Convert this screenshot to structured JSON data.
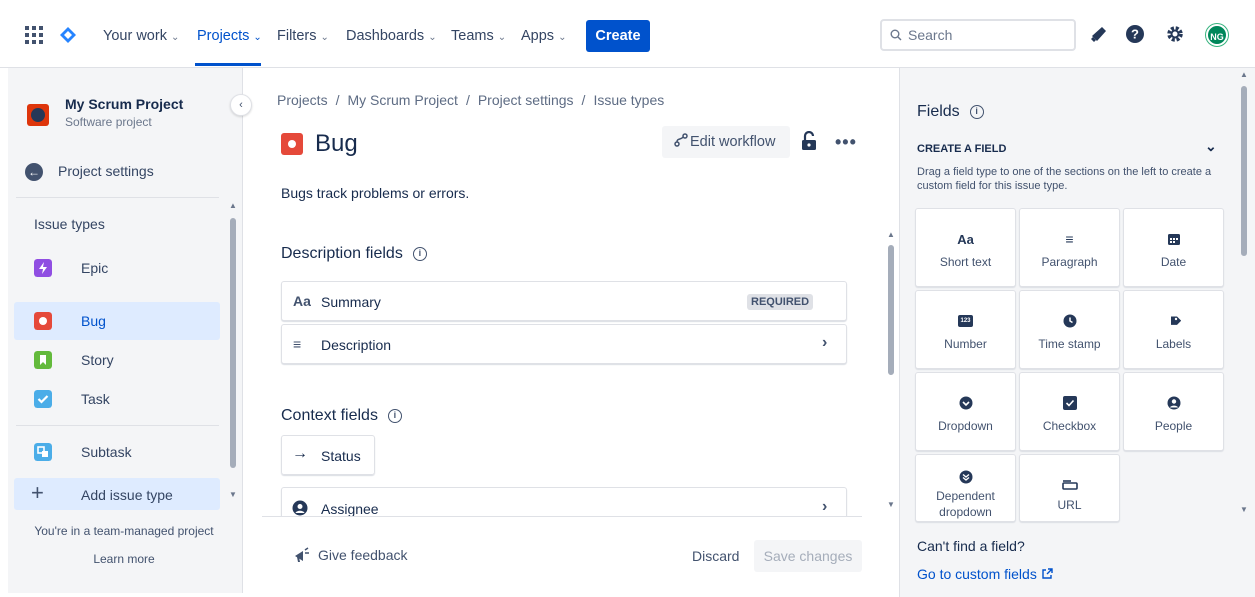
{
  "nav": {
    "your_work": "Your work",
    "projects": "Projects",
    "filters": "Filters",
    "dashboards": "Dashboards",
    "teams": "Teams",
    "apps": "Apps",
    "create": "Create",
    "search_placeholder": "Search",
    "avatar_initials": "NG",
    "chevron": "⌄",
    "accent_color": "#0052cc"
  },
  "sidebar": {
    "project_name": "My Scrum Project",
    "project_type": "Software project",
    "back_label": "Project settings",
    "section_heading": "Issue types",
    "items": [
      {
        "label": "Epic",
        "color": "#904ee2"
      },
      {
        "label": "Bug",
        "color": "#e5493a"
      },
      {
        "label": "Story",
        "color": "#63ba3c"
      },
      {
        "label": "Task",
        "color": "#4bade8"
      },
      {
        "label": "Subtask",
        "color": "#4bade8"
      },
      {
        "label": "Add issue type"
      }
    ],
    "footer_text": "You're in a team-managed project",
    "learn_more": "Learn more"
  },
  "main": {
    "breadcrumb": [
      "Projects",
      "My Scrum Project",
      "Project settings",
      "Issue types"
    ],
    "title": "Bug",
    "edit_workflow": "Edit workflow",
    "description": "Bugs track problems or errors.",
    "description_fields_heading": "Description fields",
    "description_fields": [
      {
        "label": "Summary",
        "badge": "REQUIRED"
      },
      {
        "label": "Description"
      }
    ],
    "context_fields_heading": "Context fields",
    "context_fields": [
      {
        "label": "Status"
      },
      {
        "label": "Assignee"
      }
    ],
    "give_feedback": "Give feedback",
    "discard": "Discard",
    "save_changes": "Save changes"
  },
  "fields_panel": {
    "title": "Fields",
    "create_field_heading": "CREATE A FIELD",
    "hint": "Drag a field type to one of the sections on the left to create a custom field for this issue type.",
    "tiles": [
      {
        "label": "Short text",
        "icon": "short-text-icon"
      },
      {
        "label": "Paragraph",
        "icon": "paragraph-icon"
      },
      {
        "label": "Date",
        "icon": "calendar-icon"
      },
      {
        "label": "Number",
        "icon": "number-icon"
      },
      {
        "label": "Time stamp",
        "icon": "clock-icon"
      },
      {
        "label": "Labels",
        "icon": "tag-icon"
      },
      {
        "label": "Dropdown",
        "icon": "dropdown-icon"
      },
      {
        "label": "Checkbox",
        "icon": "checkbox-icon"
      },
      {
        "label": "People",
        "icon": "person-icon"
      },
      {
        "label": "Dependent dropdown",
        "icon": "dependent-dropdown-icon"
      },
      {
        "label": "URL",
        "icon": "url-icon"
      }
    ],
    "cant_find": "Can't find a field?",
    "go_custom": "Go to custom fields"
  }
}
